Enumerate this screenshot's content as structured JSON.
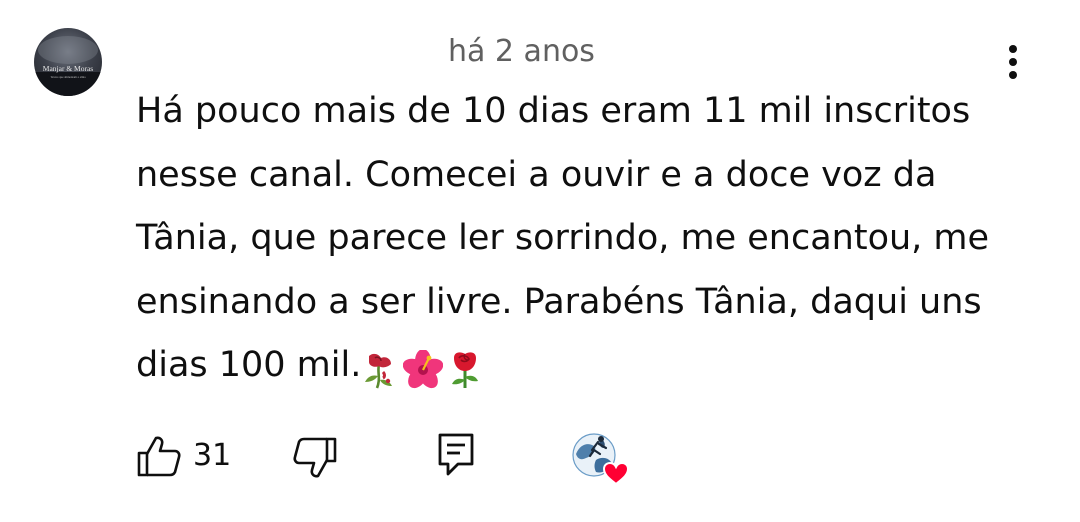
{
  "comment": {
    "timestamp": "há 2 anos",
    "avatar_text": {
      "line1": "Manjar & Moras",
      "line2": "Textos que alimentam a alma"
    },
    "text_lines": [
      "Há pouco mais de 10 dias eram 11 mil inscritos",
      "nesse canal. Comecei a ouvir e a doce voz da",
      "Tânia, que parece ler sorrindo, me encantou, me",
      "ensinando a ser livre. Parabéns Tânia, daqui uns",
      "dias 100 mil."
    ],
    "emojis": [
      "wilted-rose",
      "hibiscus",
      "rose"
    ],
    "like_count": "31"
  },
  "icons": {
    "menu": "vertical-ellipsis-icon",
    "like": "thumbs-up-icon",
    "dislike": "thumbs-down-icon",
    "reply": "reply-comment-icon",
    "creator_heart": "creator-heart-icon"
  },
  "colors": {
    "text": "#0f0f0f",
    "secondary_text": "#606060",
    "heart": "#ff0033"
  }
}
